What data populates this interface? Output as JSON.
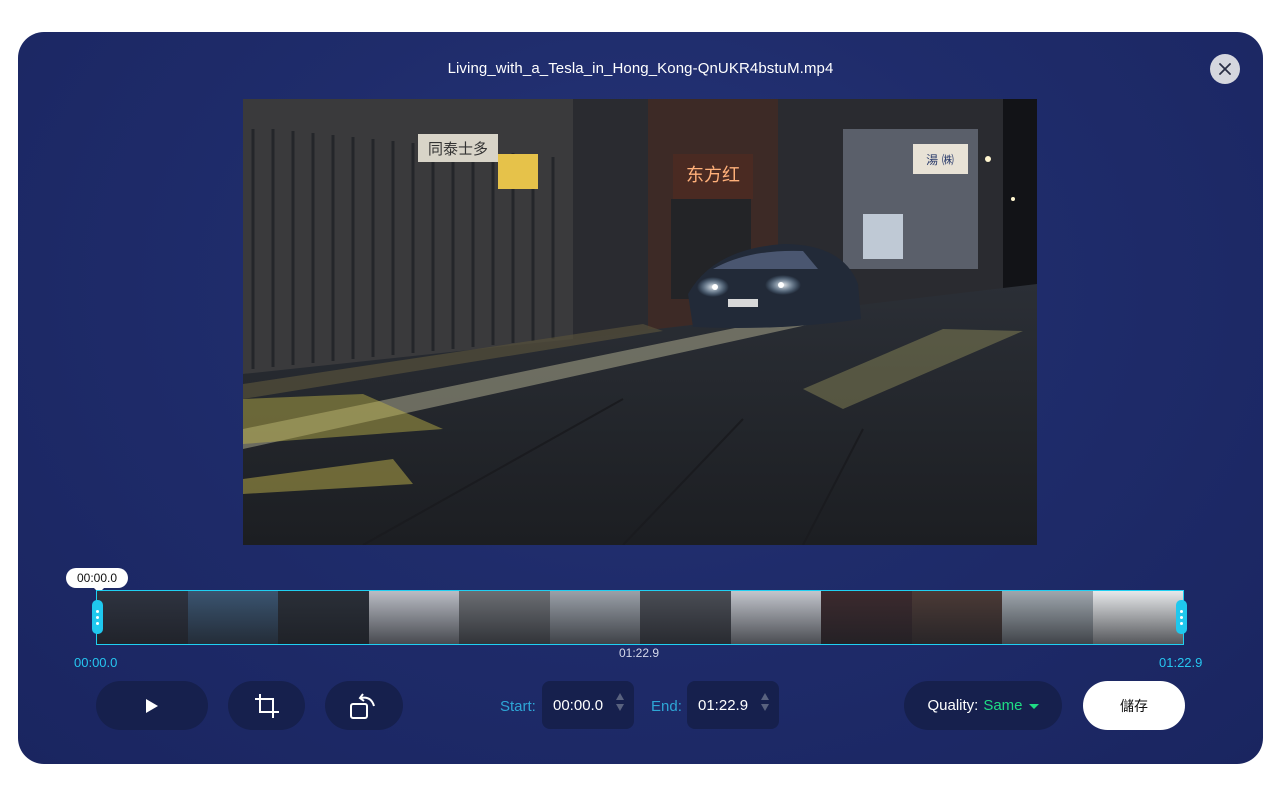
{
  "dialog": {
    "title": "Living_with_a_Tesla_in_Hong_Kong-QnUKR4bstuM.mp4"
  },
  "preview": {
    "sign_text_1": "同泰士多",
    "sign_text_2": "东方红",
    "sign_text_3": "湯 ㈱"
  },
  "timeline": {
    "current_tooltip": "00:00.0",
    "start_label": "00:00.0",
    "end_label": "01:22.9",
    "middle_label": "01:22.9",
    "thumbnail_colors": [
      "#2e3340",
      "#3a5470",
      "#2a2f38",
      "#b9bcc4",
      "#6b6e73",
      "#9aa0a8",
      "#4a4d55",
      "#c2c5cc",
      "#3c2a2e",
      "#4b3a36",
      "#9ea6ad",
      "#e6e8ea"
    ]
  },
  "controls": {
    "start_label": "Start:",
    "start_value": "00:00.0",
    "end_label": "End:",
    "end_value": "01:22.9",
    "quality_label": "Quality:",
    "quality_value": "Same",
    "save_label": "儲存"
  },
  "icons": {
    "close": "close-icon",
    "play": "play-icon",
    "crop": "crop-icon",
    "rotate": "rotate-icon",
    "caret": "chevron-down-icon"
  },
  "colors": {
    "background": "#1f2c6b",
    "accent": "#1fc8ee",
    "quality_value": "#1fdc84"
  }
}
